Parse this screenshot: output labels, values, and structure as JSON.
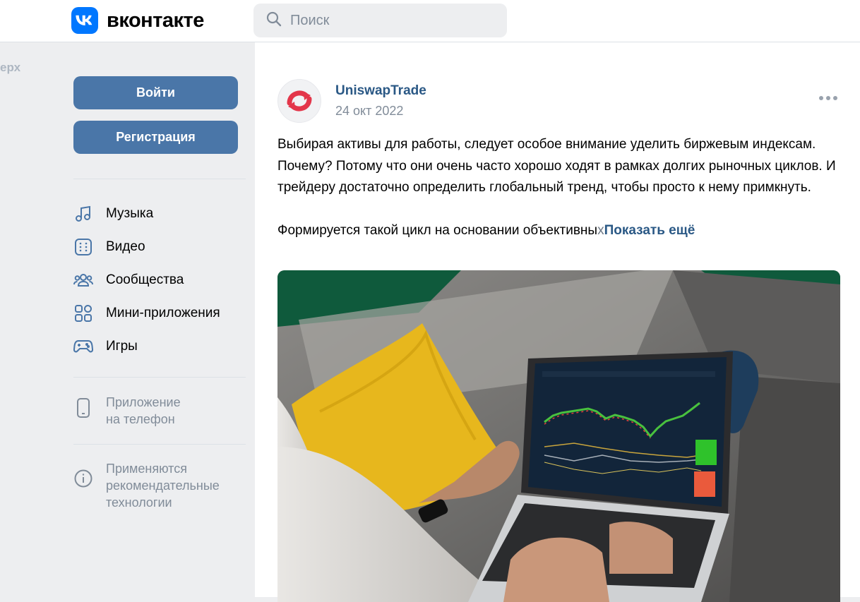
{
  "header": {
    "logo_text": "вконтакте",
    "search_placeholder": "Поиск"
  },
  "left_edge": {
    "scroll_top_label": "ерх"
  },
  "sidebar": {
    "login_label": "Войти",
    "register_label": "Регистрация",
    "nav_items": [
      {
        "label": "Музыка",
        "icon": "music-icon"
      },
      {
        "label": "Видео",
        "icon": "video-icon"
      },
      {
        "label": "Сообщества",
        "icon": "communities-icon"
      },
      {
        "label": "Мини-приложения",
        "icon": "mini-apps-icon"
      },
      {
        "label": "Игры",
        "icon": "games-icon"
      }
    ],
    "app_line1": "Приложение",
    "app_line2": "на телефон",
    "rec_line1": "Применяются",
    "rec_line2": "рекомендательные",
    "rec_line3": "технологии"
  },
  "post": {
    "author": "UniswapTrade",
    "date": "24 окт 2022",
    "paragraph1": "Выбирая активы для работы, следует особое внимание уделить биржевым индексам. Почему? Потому что они очень часто хорошо ходят в рамках долгих рыночных циклов. И трейдеру достаточно определить глобальный тренд, чтобы просто к нему примкнуть.",
    "paragraph2_main": "Формируется такой цикл на основании объективны",
    "paragraph2_fade": "х",
    "show_more": "Показать ещё"
  },
  "colors": {
    "accent": "#4a76a8",
    "link": "#2a5885",
    "vk_blue": "#0077ff",
    "muted": "#818c99",
    "avatar_red": "#e3364a"
  }
}
